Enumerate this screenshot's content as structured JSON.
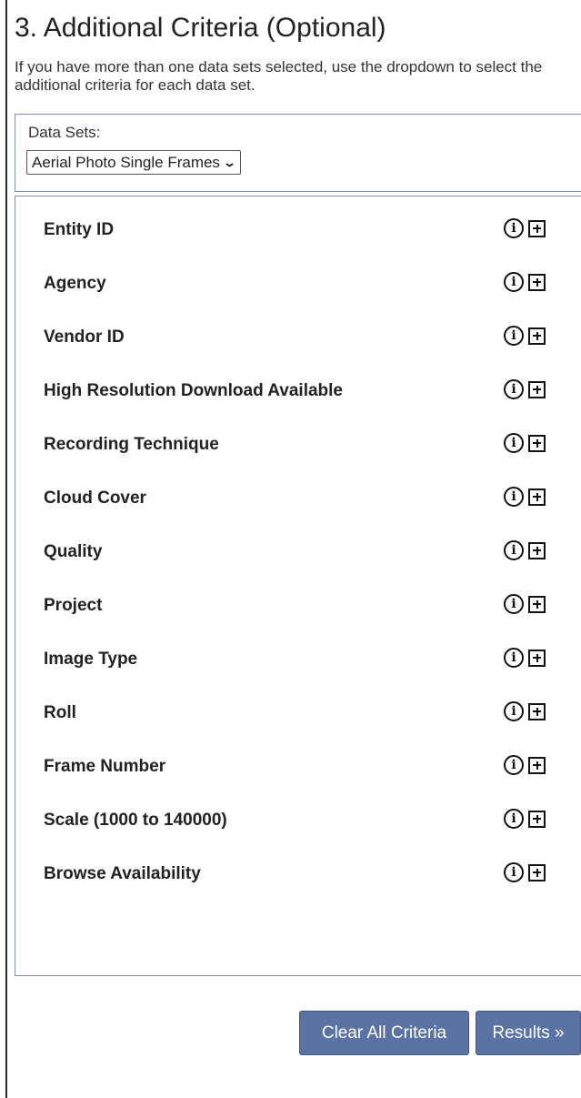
{
  "section": {
    "title": "3. Additional Criteria (Optional)",
    "description": "If you have more than one data sets selected, use the dropdown to select the additional criteria for each data set."
  },
  "dataset": {
    "label": "Data Sets:",
    "selected": "Aerial Photo Single Frames"
  },
  "criteria": [
    {
      "label": "Entity ID"
    },
    {
      "label": "Agency"
    },
    {
      "label": "Vendor ID"
    },
    {
      "label": "High Resolution Download Available"
    },
    {
      "label": "Recording Technique"
    },
    {
      "label": "Cloud Cover"
    },
    {
      "label": "Quality"
    },
    {
      "label": "Project"
    },
    {
      "label": "Image Type"
    },
    {
      "label": "Roll"
    },
    {
      "label": "Frame Number"
    },
    {
      "label": "Scale (1000 to 140000)"
    },
    {
      "label": "Browse Availability"
    }
  ],
  "buttons": {
    "clear": "Clear All Criteria",
    "results": "Results »"
  },
  "colors": {
    "button_bg": "#5a73a4",
    "panel_border": "#7e8fb7"
  },
  "icons": {
    "info": "info-circle-icon",
    "expand": "plus-square-icon",
    "dropdown": "chevron-down-icon"
  }
}
